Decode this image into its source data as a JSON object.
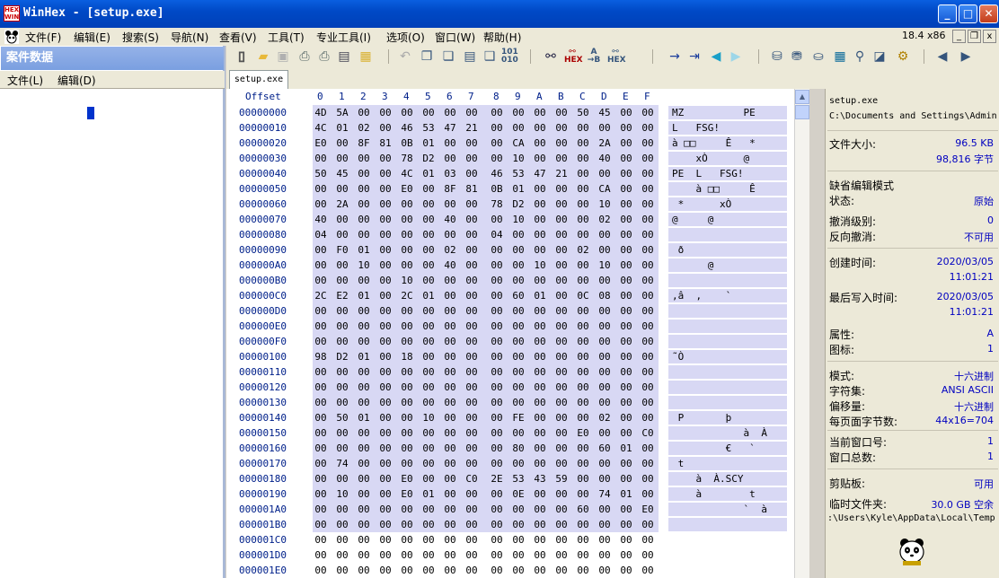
{
  "window": {
    "title": "WinHex - [setup.exe]",
    "icon": "winhex-logo-icon",
    "minimize": "_",
    "maximize": "□",
    "close": "✕"
  },
  "menubar": {
    "items": [
      "文件(F)",
      "编辑(E)",
      "搜索(S)",
      "导航(N)",
      "查看(V)",
      "工具(T)",
      "专业工具(I)",
      "选项(O)",
      "窗口(W)",
      "帮助(H)"
    ],
    "status": "18.4 x86",
    "mdi_minimize": "_",
    "mdi_restore": "❐",
    "mdi_close": "x"
  },
  "left_panel": {
    "title": "案件数据",
    "menu": [
      "文件(L)",
      "编辑(D)"
    ]
  },
  "tab": {
    "label": "setup.exe"
  },
  "hex": {
    "offset_label": "Offset",
    "columns": [
      "0",
      "1",
      "2",
      "3",
      "4",
      "5",
      "6",
      "7",
      "8",
      "9",
      "A",
      "B",
      "C",
      "D",
      "E",
      "F"
    ],
    "rows": [
      {
        "offset": "00000000",
        "bytes": "4D 5A 00 00 00 00 00 00 00 00 00 00 50 45 00 00",
        "ascii": "MZ          PE"
      },
      {
        "offset": "00000010",
        "bytes": "4C 01 02 00 46 53 47 21 00 00 00 00 00 00 00 00",
        "ascii": "L   FSG!"
      },
      {
        "offset": "00000020",
        "bytes": "E0 00 8F 81 0B 01 00 00 00 CA 00 00 00 2A 00 00",
        "ascii": "à □□     Ê   *"
      },
      {
        "offset": "00000030",
        "bytes": "00 00 00 00 78 D2 00 00 00 10 00 00 00 40 00 00",
        "ascii": "    xÒ      @"
      },
      {
        "offset": "00000040",
        "bytes": "50 45 00 00 4C 01 03 00 46 53 47 21 00 00 00 00",
        "ascii": "PE  L   FSG!"
      },
      {
        "offset": "00000050",
        "bytes": "00 00 00 00 E0 00 8F 81 0B 01 00 00 00 CA 00 00",
        "ascii": "    à □□     Ê"
      },
      {
        "offset": "00000060",
        "bytes": "00 2A 00 00 00 00 00 00 78 D2 00 00 00 10 00 00",
        "ascii": " *      xÒ"
      },
      {
        "offset": "00000070",
        "bytes": "40 00 00 00 00 00 40 00 00 10 00 00 00 02 00 00",
        "ascii": "@     @"
      },
      {
        "offset": "00000080",
        "bytes": "04 00 00 00 00 00 00 00 04 00 00 00 00 00 00 00",
        "ascii": ""
      },
      {
        "offset": "00000090",
        "bytes": "00 F0 01 00 00 00 02 00 00 00 00 00 02 00 00 00",
        "ascii": " ð"
      },
      {
        "offset": "000000A0",
        "bytes": "00 00 10 00 00 00 40 00 00 00 10 00 00 10 00 00",
        "ascii": "      @"
      },
      {
        "offset": "000000B0",
        "bytes": "00 00 00 00 10 00 00 00 00 00 00 00 00 00 00 00",
        "ascii": ""
      },
      {
        "offset": "000000C0",
        "bytes": "2C E2 01 00 2C 01 00 00 00 60 01 00 0C 08 00 00",
        "ascii": ",â  ,    `"
      },
      {
        "offset": "000000D0",
        "bytes": "00 00 00 00 00 00 00 00 00 00 00 00 00 00 00 00",
        "ascii": ""
      },
      {
        "offset": "000000E0",
        "bytes": "00 00 00 00 00 00 00 00 00 00 00 00 00 00 00 00",
        "ascii": ""
      },
      {
        "offset": "000000F0",
        "bytes": "00 00 00 00 00 00 00 00 00 00 00 00 00 00 00 00",
        "ascii": ""
      },
      {
        "offset": "00000100",
        "bytes": "98 D2 01 00 18 00 00 00 00 00 00 00 00 00 00 00",
        "ascii": "˜Ò"
      },
      {
        "offset": "00000110",
        "bytes": "00 00 00 00 00 00 00 00 00 00 00 00 00 00 00 00",
        "ascii": ""
      },
      {
        "offset": "00000120",
        "bytes": "00 00 00 00 00 00 00 00 00 00 00 00 00 00 00 00",
        "ascii": ""
      },
      {
        "offset": "00000130",
        "bytes": "00 00 00 00 00 00 00 00 00 00 00 00 00 00 00 00",
        "ascii": ""
      },
      {
        "offset": "00000140",
        "bytes": "00 50 01 00 00 10 00 00 00 FE 00 00 00 02 00 00",
        "ascii": " P       þ"
      },
      {
        "offset": "00000150",
        "bytes": "00 00 00 00 00 00 00 00 00 00 00 00 E0 00 00 C0",
        "ascii": "            à  À"
      },
      {
        "offset": "00000160",
        "bytes": "00 00 00 00 00 00 00 00 00 80 00 00 00 60 01 00",
        "ascii": "         €   `"
      },
      {
        "offset": "00000170",
        "bytes": "00 74 00 00 00 00 00 00 00 00 00 00 00 00 00 00",
        "ascii": " t"
      },
      {
        "offset": "00000180",
        "bytes": "00 00 00 00 E0 00 00 C0 2E 53 43 59 00 00 00 00",
        "ascii": "    à  À.SCY"
      },
      {
        "offset": "00000190",
        "bytes": "00 10 00 00 E0 01 00 00 00 0E 00 00 00 74 01 00",
        "ascii": "    à        t"
      },
      {
        "offset": "000001A0",
        "bytes": "00 00 00 00 00 00 00 00 00 00 00 00 60 00 00 E0",
        "ascii": "            `  à"
      },
      {
        "offset": "000001B0",
        "bytes": "00 00 00 00 00 00 00 00 00 00 00 00 00 00 00 00",
        "ascii": ""
      },
      {
        "offset": "000001C0",
        "bytes": "00 00 00 00 00 00 00 00 00 00 00 00 00 00 00 00",
        "ascii": ""
      },
      {
        "offset": "000001D0",
        "bytes": "00 00 00 00 00 00 00 00 00 00 00 00 00 00 00 00",
        "ascii": ""
      },
      {
        "offset": "000001E0",
        "bytes": "00 00 00 00 00 00 00 00 00 00 00 00 00 00 00 00",
        "ascii": ""
      }
    ]
  },
  "info": {
    "filename": "setup.exe",
    "path": "C:\\Documents and Settings\\Admin",
    "file_size_label": "文件大小:",
    "file_size_kb": "96.5 KB",
    "file_size_bytes": "98,816 字节",
    "edit_mode_label": "缺省编辑模式",
    "state_label": "状态:",
    "state": "原始",
    "undo_label": "撤消级别:",
    "undo": "0",
    "redo_label": "反向撤消:",
    "redo": "不可用",
    "created_label": "创建时间:",
    "created_date": "2020/03/05",
    "created_time": "11:01:21",
    "written_label": "最后写入时间:",
    "written_date": "2020/03/05",
    "written_time": "11:01:21",
    "attr_label": "属性:",
    "attr": "A",
    "icons_label": "图标:",
    "icons": "1",
    "mode_label": "模式:",
    "mode": "十六进制",
    "charset_label": "字符集:",
    "charset": "ANSI ASCII",
    "offset_label": "偏移量:",
    "offset": "十六进制",
    "bpp_label": "每页面字节数:",
    "bpp": "44x16=704",
    "curwin_label": "当前窗口号:",
    "curwin": "1",
    "totwin_label": "窗口总数:",
    "totwin": "1",
    "clip_label": "剪贴板:",
    "clip": "可用",
    "temp_label": "临时文件夹:",
    "temp_free": "30.0 GB 空余",
    "temp_path": ":\\Users\\Kyle\\AppData\\Local\\Temp"
  },
  "toolbar_icons": [
    "new-file-icon",
    "open-folder-icon",
    "save-icon",
    "print-preview-icon",
    "print-icon",
    "properties-icon",
    "open-disk-icon",
    "undo-icon",
    "copy-icon",
    "copy-block-icon",
    "paste-icon",
    "paste-special-icon",
    "convert-icon",
    "find-icon",
    "find-hex-icon",
    "replace-icon",
    "replace-hex-icon",
    "goto-offset-icon",
    "goto-sector-icon",
    "back-icon",
    "forward-icon",
    "disk-editor-icon",
    "ram-editor-icon",
    "tape-icon",
    "calculator-icon",
    "analyze-icon",
    "hash-icon",
    "settings-icon",
    "prev-window-icon",
    "next-window-icon"
  ]
}
